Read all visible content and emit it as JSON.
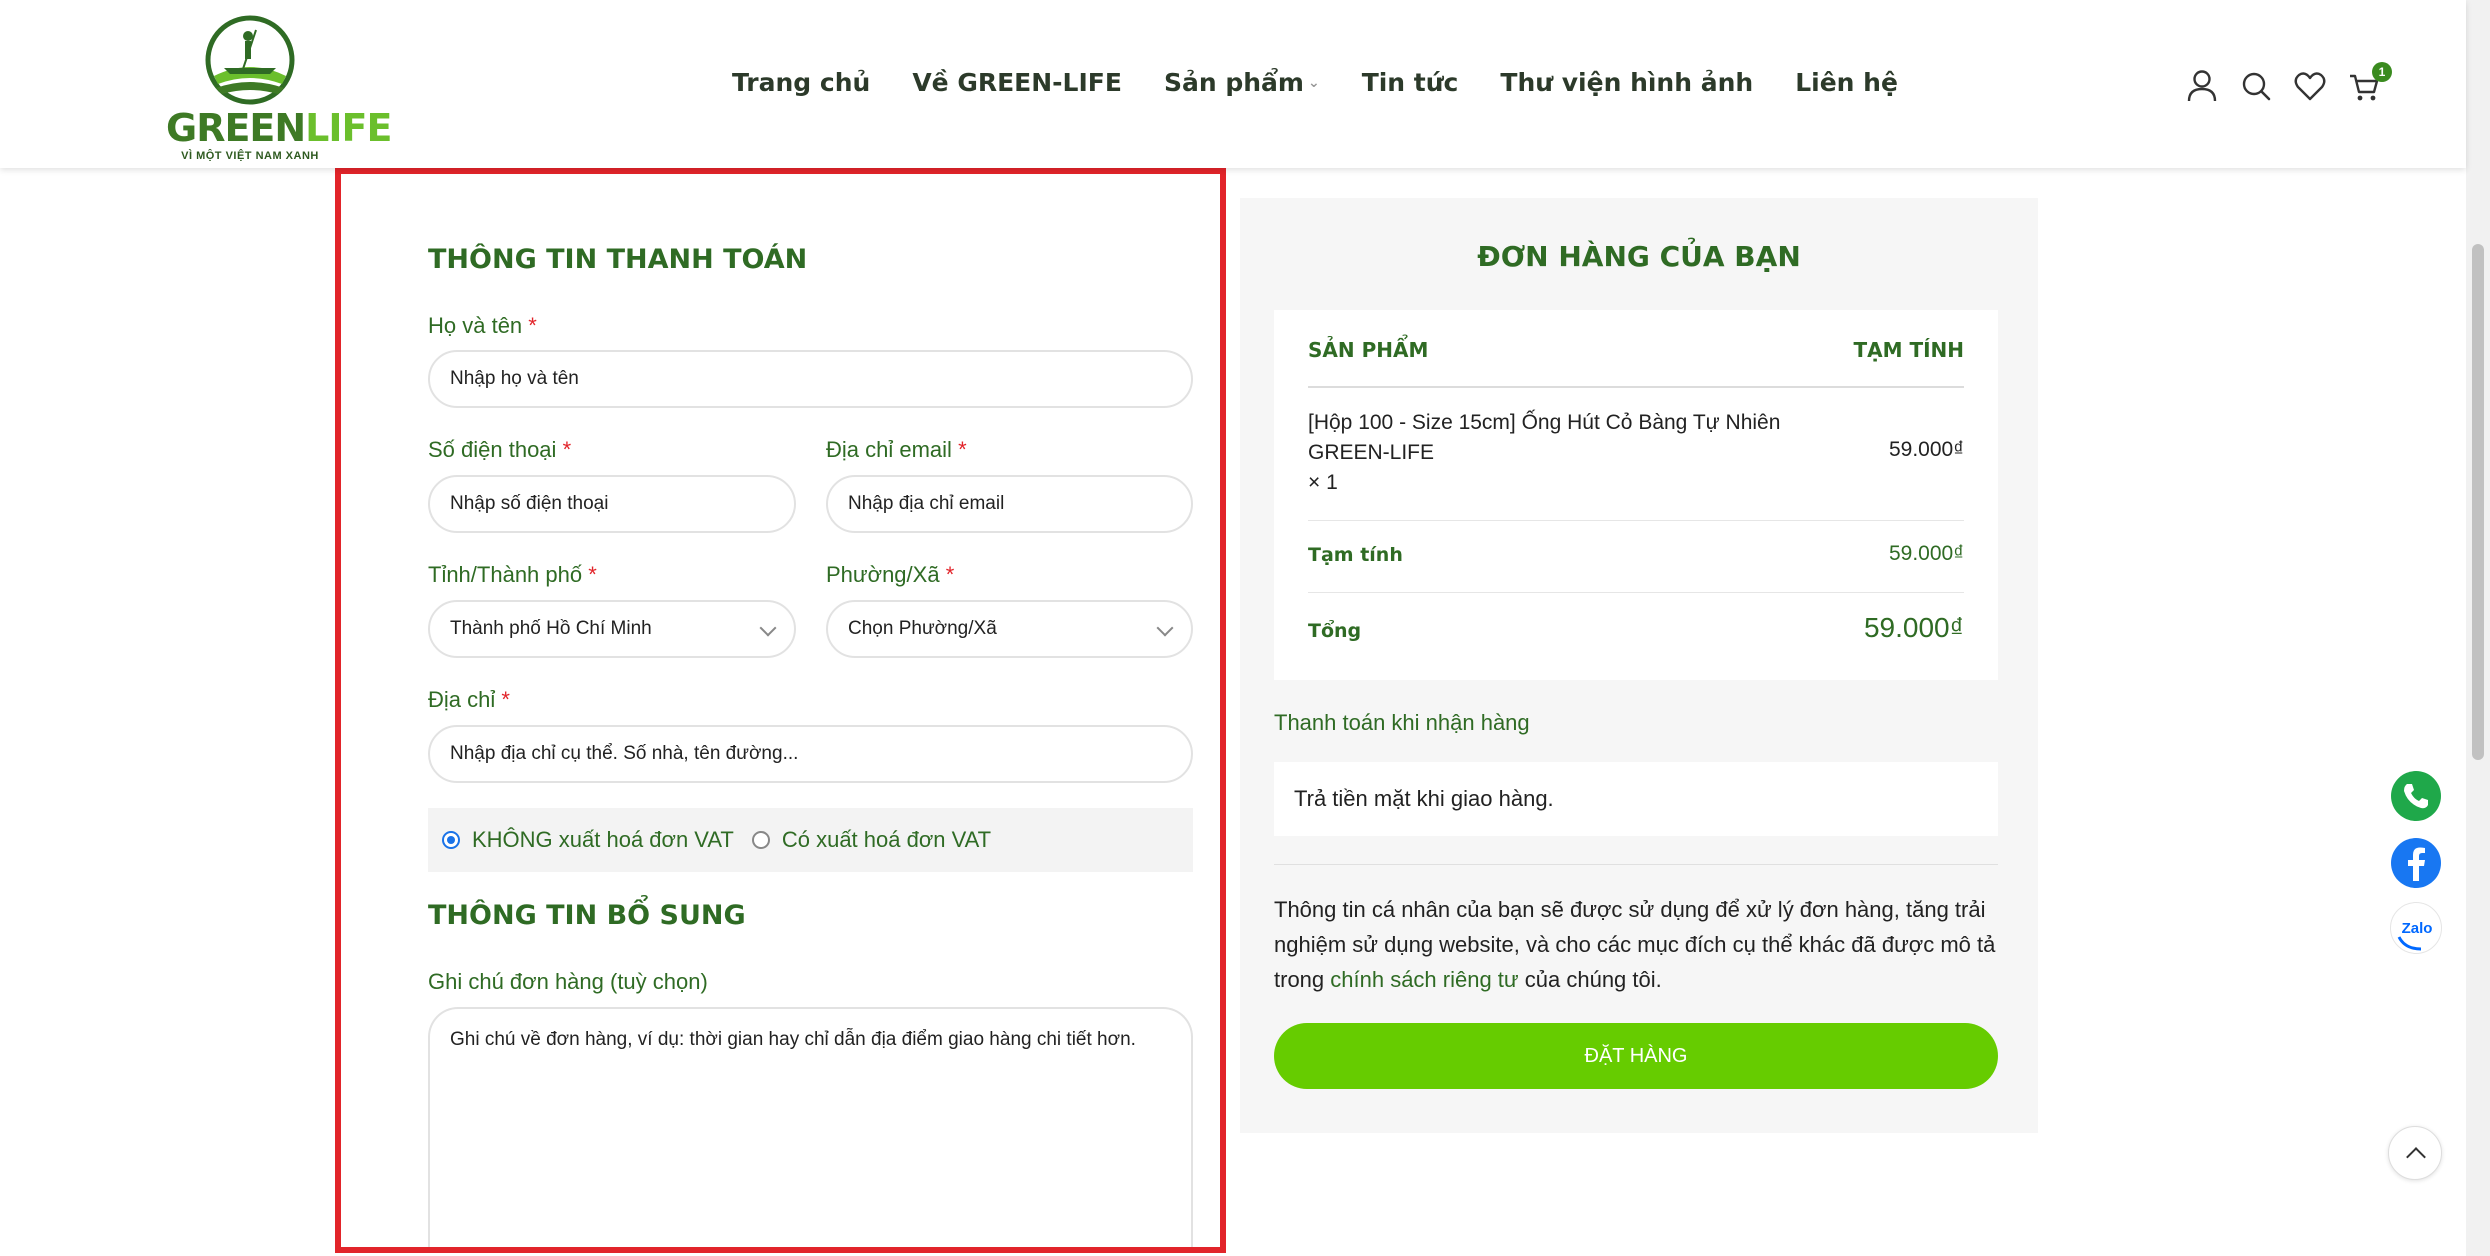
{
  "header": {
    "logo": {
      "text_a": "GREEN",
      "text_b": "LIFE",
      "tagline": "VÌ MỘT VIỆT NAM XANH"
    },
    "nav": [
      {
        "label": "Trang chủ"
      },
      {
        "label": "Về GREEN-LIFE"
      },
      {
        "label": "Sản phẩm",
        "has_dropdown": true
      },
      {
        "label": "Tin tức"
      },
      {
        "label": "Thư viện hình ảnh"
      },
      {
        "label": "Liên hệ"
      }
    ],
    "icons": [
      "user-icon",
      "search-icon",
      "heart-icon",
      "cart-icon"
    ],
    "cart_count": "1"
  },
  "billing": {
    "title": "THÔNG TIN THANH TOÁN",
    "required_mark": "*",
    "fullname": {
      "label": "Họ và tên",
      "placeholder": "Nhập họ và tên"
    },
    "phone": {
      "label": "Số điện thoại",
      "placeholder": "Nhập số điện thoại"
    },
    "email": {
      "label": "Địa chỉ email",
      "placeholder": "Nhập địa chỉ email"
    },
    "province": {
      "label": "Tỉnh/Thành phố",
      "value": "Thành phố Hồ Chí Minh"
    },
    "ward": {
      "label": "Phường/Xã",
      "value": "Chọn Phường/Xã"
    },
    "address": {
      "label": "Địa chỉ",
      "placeholder": "Nhập địa chỉ cụ thể. Số nhà, tên đường..."
    },
    "vat": {
      "option_no": "KHÔNG xuất hoá đơn VAT",
      "option_yes": "Có xuất hoá đơn VAT",
      "selected": "no"
    }
  },
  "additional": {
    "title": "THÔNG TIN BỔ SUNG",
    "note_label": "Ghi chú đơn hàng (tuỳ chọn)",
    "note_placeholder": "Ghi chú về đơn hàng, ví dụ: thời gian hay chỉ dẫn địa điểm giao hàng chi tiết hơn."
  },
  "order": {
    "title": "ĐƠN HÀNG CỦA BẠN",
    "col_product": "SẢN PHẨM",
    "col_subtotal": "TẠM TÍNH",
    "item": {
      "name_line1": "[Hộp 100 - Size 15cm] Ống Hút Cỏ Bàng Tự Nhiên",
      "name_line2": "GREEN-LIFE",
      "qty": "× 1",
      "price": "59.000₫"
    },
    "subtotal_label": "Tạm tính",
    "subtotal_value": "59.000₫",
    "total_label": "Tổng",
    "total_value": "59.000₫",
    "payment_label": "Thanh toán khi nhận hàng",
    "payment_desc": "Trả tiền mặt khi giao hàng.",
    "privacy_before": "Thông tin cá nhân của bạn sẽ được sử dụng để xử lý đơn hàng, tăng trải nghiệm sử dụng website, và cho các mục đích cụ thể khác đã được mô tả trong ",
    "privacy_link": "chính sách riêng tư",
    "privacy_after": " của chúng tôi.",
    "place_order": "ĐẶT HÀNG"
  },
  "floating": {
    "zalo_label": "Zalo",
    "accent": "#66cc00",
    "green_dark": "#2f6b24",
    "highlight_border": "#e2242a"
  }
}
